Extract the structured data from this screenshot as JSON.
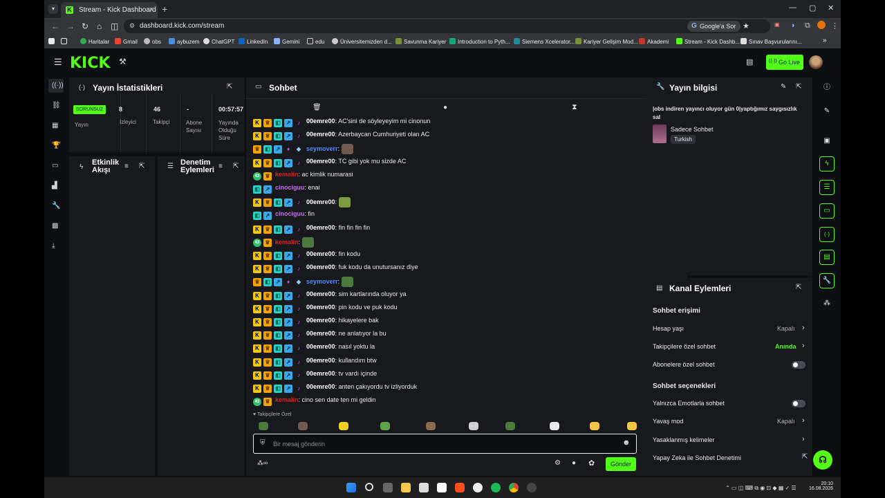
{
  "browser": {
    "tab_title": "Stream - Kick Dashboard",
    "url": "dashboard.kick.com/stream",
    "google_button": "Google'a Sor",
    "bookmarks": [
      "Haritalar",
      "Gmail",
      "obs",
      "aybuzem",
      "ChatGPT",
      "LinkedIn",
      "Gemini",
      "edu",
      "Üniversitemizden d...",
      "Savunma Kariyer",
      "Introduction to Pyth...",
      "Siemens Xcelerator...",
      "Kariyer Gelişim Mod...",
      "Akademi",
      "Stream - Kick Dashb...",
      "Sınav Başvurularını..."
    ]
  },
  "header": {
    "logo": "KICK",
    "go_live": "Go Live"
  },
  "stats": {
    "title": "Yayın İstatistikleri",
    "status_badge": "SORUNSUZ",
    "status_label": "Yayın",
    "viewers_value": "8",
    "viewers_label": "İzleyici",
    "followers_value": "46",
    "followers_label": "Takipçi",
    "subs_value": "-",
    "subs_label": "Abone Sayısı",
    "uptime_value": "00:57:57",
    "uptime_label": "Yayında Olduğu Süre"
  },
  "activity": {
    "title": "Etkinlik Akışı"
  },
  "moderation": {
    "title": "Denetim Eylemleri"
  },
  "chat": {
    "title": "Sohbet",
    "input_placeholder": "Bir mesaj gönderin",
    "send_label": "Gönder",
    "followers_only_note": "Takipçilere Özel",
    "messages": [
      {
        "user": "00emre00",
        "badges": "kcta m",
        "text": "AC'sini de söyleyeyim mi cinonun",
        "color": "#ffffff"
      },
      {
        "user": "00emre00",
        "badges": "kcta m",
        "text": "Azerbaycan Cumhuriyeti olan AC",
        "color": "#ffffff"
      },
      {
        "user": "seymoverr",
        "badges": "ctaig",
        "text": "",
        "emote": "#6f5a52",
        "color": "#4f8bff"
      },
      {
        "user": "00emre00",
        "badges": "kcta m",
        "text": "TC gibi yok mu sizde AC",
        "color": "#ffffff"
      },
      {
        "user": "kemalin",
        "badges": "nc",
        "text": "ac kimlik numarasi",
        "color": "#e0202a"
      },
      {
        "user": "cinociguu",
        "badges": "ta",
        "text": "enai",
        "color": "#c46cf0"
      },
      {
        "user": "00emre00",
        "badges": "kcta m",
        "text": "",
        "emote": "#7b9a3d",
        "color": "#ffffff"
      },
      {
        "user": "cinociguu",
        "badges": "ta",
        "text": "fin",
        "color": "#c46cf0"
      },
      {
        "user": "00emre00",
        "badges": "kcta m",
        "text": "fin fin fin fin",
        "color": "#ffffff"
      },
      {
        "user": "kemalin",
        "badges": "nc",
        "text": "",
        "emote": "#4b7a3c",
        "color": "#e0202a"
      },
      {
        "user": "00emre00",
        "badges": "kcta m",
        "text": "fin kodu",
        "color": "#ffffff"
      },
      {
        "user": "00emre00",
        "badges": "kcta m",
        "text": "fuk kodu da unutursanız diye",
        "color": "#ffffff"
      },
      {
        "user": "seymoverr",
        "badges": "ctaig",
        "text": "",
        "emote": "#4b7a3c",
        "color": "#4f8bff"
      },
      {
        "user": "00emre00",
        "badges": "kcta m",
        "text": "sim kartlarında oluyor ya",
        "color": "#ffffff"
      },
      {
        "user": "00emre00",
        "badges": "kcta m",
        "text": "pin kodu ve puk kodu",
        "color": "#ffffff"
      },
      {
        "user": "00emre00",
        "badges": "kcta m",
        "text": "hikayelere bak",
        "color": "#ffffff"
      },
      {
        "user": "00emre00",
        "badges": "kcta m",
        "text": "ne anlatıyor la bu",
        "color": "#ffffff"
      },
      {
        "user": "00emre00",
        "badges": "kcta m",
        "text": "nasıl yoktu la",
        "color": "#ffffff"
      },
      {
        "user": "00emre00",
        "badges": "kcta m",
        "text": "kullandım btw",
        "color": "#ffffff"
      },
      {
        "user": "00emre00",
        "badges": "kcta m",
        "text": "tv vardı içinde",
        "color": "#ffffff"
      },
      {
        "user": "00emre00",
        "badges": "kcta m",
        "text": "anten çakıyordu tv izliyorduk",
        "color": "#ffffff"
      },
      {
        "user": "kemalin",
        "badges": "nc",
        "text": "cino sen date ten mi geldin",
        "color": "#e0202a"
      }
    ],
    "emote_bar": [
      "#4b7a3c",
      "#6f5a52",
      "#f0d020",
      "#5da34a",
      "#8b6a4e",
      "#d0d0d0",
      "#4b7a3c",
      "#e8e8e8",
      "#f4c542",
      "#f4c542"
    ]
  },
  "stream_info": {
    "title": "Yayın bilgisi",
    "stream_title": "|obs indiren yayıncı oluyor gün 0|yaptığımız saygısızlık sal",
    "category": "Sadece Sohbet",
    "language_tag": "Turkish"
  },
  "channel_actions": {
    "title": "Kanal Eylemleri",
    "chat_access_heading": "Sohbet erişimi",
    "account_age_label": "Hesap yaşı",
    "account_age_value": "Kapalı",
    "followers_chat_label": "Takipçilere özel sohbet",
    "followers_chat_value": "Anında",
    "subscribers_chat_label": "Abonelere özel sohbet",
    "chat_options_heading": "Sohbet seçenekleri",
    "emote_only_label": "Yalnızca Emotlarla sohbet",
    "slow_mode_label": "Yavaş mod",
    "slow_mode_value": "Kapalı",
    "banned_words_label": "Yasaklanmış kelimeler",
    "ai_moderation_label": "Yapay Zeka ile Sohbet Denetimi"
  },
  "taskbar": {
    "time": "20:10",
    "date": "16.08.2026"
  },
  "colors": {
    "accent": "#53fc18",
    "panel": "#18191c",
    "background": "#0d0f12"
  }
}
